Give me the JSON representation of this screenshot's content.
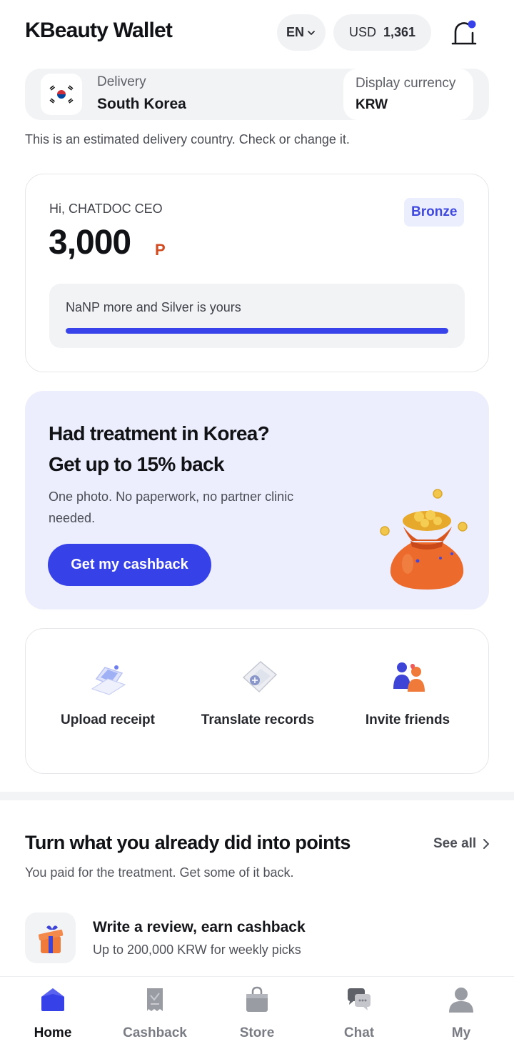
{
  "header": {
    "title": "KBeauty Wallet",
    "language": "EN",
    "currency_code": "USD",
    "currency_rate": "1,361"
  },
  "delivery": {
    "label": "Delivery",
    "country": "South Korea",
    "display_currency_label": "Display currency",
    "display_currency_value": "KRW",
    "note": "This is an estimated delivery country. Check or change it."
  },
  "points": {
    "greeting": "Hi, CHATDOC CEO",
    "tier": "Bronze",
    "value": "3,000",
    "unit": "P",
    "progress_text": "NaNP more and Silver is yours",
    "progress_fraction": 1.0
  },
  "promo": {
    "title_line1": "Had treatment in Korea?",
    "title_line2": "Get up to 15% back",
    "subtitle": "One photo. No paperwork, no partner clinic needed.",
    "button": "Get my cashback"
  },
  "actions": [
    {
      "label": "Upload receipt",
      "icon": "receipt-upload-icon"
    },
    {
      "label": "Translate records",
      "icon": "translate-document-icon"
    },
    {
      "label": "Invite friends",
      "icon": "friends-icon"
    }
  ],
  "section": {
    "title": "Turn what you already did into points",
    "see_all": "See all",
    "subtitle": "You paid for the treatment. Get some of it back.",
    "items": [
      {
        "title": "Write a review, earn cashback",
        "subtitle": "Up to 200,000 KRW for weekly picks",
        "icon": "gift-box-icon"
      }
    ]
  },
  "nav": [
    {
      "label": "Home",
      "icon": "home-icon",
      "active": true
    },
    {
      "label": "Cashback",
      "icon": "receipt-icon",
      "active": false
    },
    {
      "label": "Store",
      "icon": "shopping-bag-icon",
      "active": false
    },
    {
      "label": "Chat",
      "icon": "chat-bubbles-icon",
      "active": false
    },
    {
      "label": "My",
      "icon": "profile-icon",
      "active": false
    }
  ],
  "colors": {
    "accent": "#3741e8",
    "promo_bg": "#eceefd",
    "points_unit": "#d24a1f",
    "notification_dot": "#3741e8"
  }
}
